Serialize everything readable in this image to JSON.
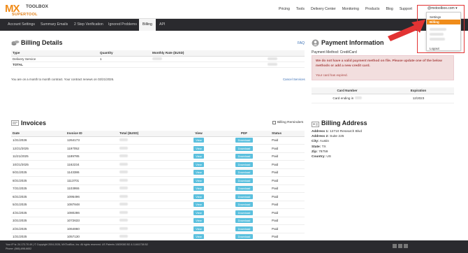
{
  "header": {
    "logo_mx": "MX",
    "logo_toolbox": "TOOLBOX",
    "logo_super": "SUPERTOOL",
    "nav": [
      "Pricing",
      "Tools",
      "Delivery Center",
      "Monitoring",
      "Products",
      "Blog",
      "Support"
    ],
    "user_email": "@mxtoolbox.com ▾"
  },
  "subnav": {
    "tabs": [
      "Account Settings",
      "Summary Emails",
      "2 Step Verification",
      "Ignored Problems",
      "Billing",
      "API"
    ],
    "active": "Billing"
  },
  "billing_details": {
    "title": "Billing Details",
    "faq": "FAQ",
    "columns": [
      "Type",
      "Quantity",
      "Monthly Rate ($USD)"
    ],
    "rows": [
      {
        "type": "Delivery Service",
        "quantity": "1"
      },
      {
        "type": "TOTAL",
        "quantity": ""
      }
    ],
    "contract_note": "You are on a month to month contract. Your contract renews on 02/21/2026.",
    "cancel_label": "Cancel Services"
  },
  "payment": {
    "title": "Payment Information",
    "method": "Payment Method: CreditCard",
    "alert": "We do not have a valid payment method on file. Please update one of the below methods or add a new credit card.",
    "expired": "Your card has expired.",
    "columns": [
      "Card Number",
      "Expiration"
    ],
    "card_label": "Card ending in",
    "expiration": "12/2023"
  },
  "invoices": {
    "title": "Invoices",
    "reminders_label": "Billing Reminders",
    "columns": [
      "Date",
      "Invoice ID",
      "Total ($USD)",
      "View",
      "PDF",
      "Status"
    ],
    "view_label": "View",
    "download_label": "Download",
    "rows": [
      {
        "date": "1/21/2026",
        "id": "1264173",
        "status": "Paid"
      },
      {
        "date": "12/21/2025",
        "id": "1197052",
        "status": "Paid"
      },
      {
        "date": "11/21/2025",
        "id": "1189785",
        "status": "Paid"
      },
      {
        "date": "10/21/2025",
        "id": "1162234",
        "status": "Paid"
      },
      {
        "date": "9/21/2025",
        "id": "1143386",
        "status": "Paid"
      },
      {
        "date": "8/21/2025",
        "id": "1113701",
        "status": "Paid"
      },
      {
        "date": "7/21/2025",
        "id": "1103955",
        "status": "Paid"
      },
      {
        "date": "6/21/2025",
        "id": "1095496",
        "status": "Paid"
      },
      {
        "date": "5/21/2025",
        "id": "1087848",
        "status": "Paid"
      },
      {
        "date": "4/21/2025",
        "id": "1080286",
        "status": "Paid"
      },
      {
        "date": "3/21/2025",
        "id": "1072633",
        "status": "Paid"
      },
      {
        "date": "2/21/2025",
        "id": "1064860",
        "status": "Paid"
      },
      {
        "date": "1/21/2025",
        "id": "1057130",
        "status": "Paid"
      }
    ]
  },
  "billing_address": {
    "title": "Billing Address",
    "lines": [
      {
        "label": "Address 1:",
        "value": "12710 Research Blvd"
      },
      {
        "label": "Address 2:",
        "value": "Suite 225"
      },
      {
        "label": "City:",
        "value": "Austin"
      },
      {
        "label": "State:",
        "value": "TX"
      },
      {
        "label": "Zip:",
        "value": "78759"
      },
      {
        "label": "Country:",
        "value": "US"
      }
    ]
  },
  "dropdown": {
    "items": [
      "Settings",
      "Billing",
      "Logout"
    ],
    "active": "Billing"
  },
  "footer": {
    "line1": "Your IP is: 24.173.70.49 | © Copyright 2004-2026, MXToolBox, Inc. All rights reserved. US Patents 10839383 B2 & 11461738 B2",
    "line2": "Phone: (866)-698-6652"
  },
  "colors": {
    "accent": "#f08c1a",
    "link": "#3a6fb5",
    "alert_bg": "#f2dede",
    "alert_text": "#a94442",
    "button": "#5bc0de",
    "highlight": "#e23333"
  }
}
